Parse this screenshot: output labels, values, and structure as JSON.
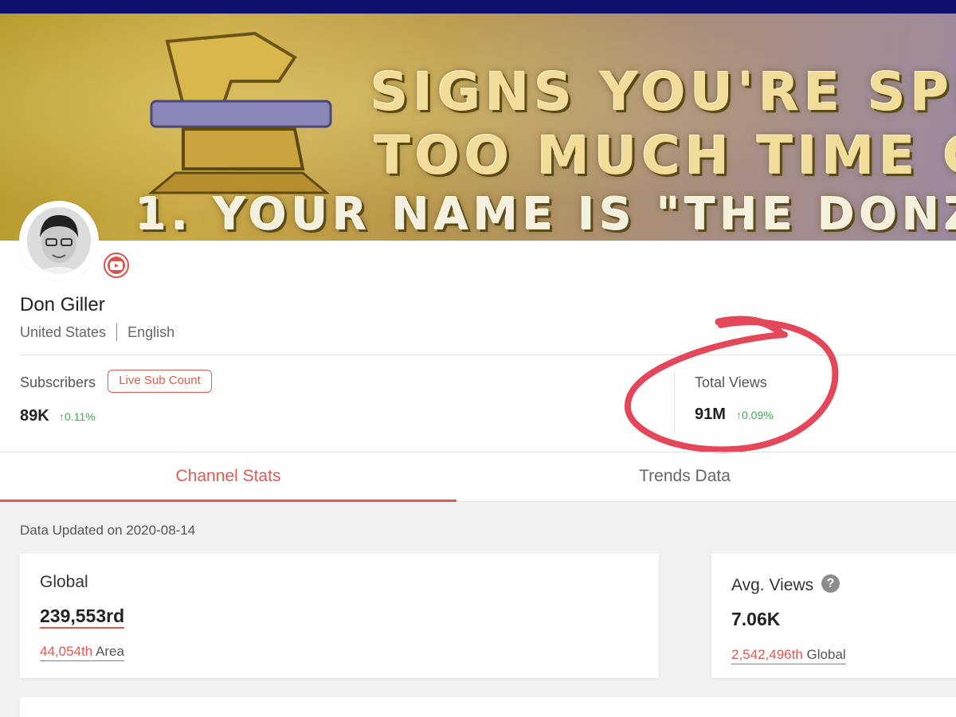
{
  "banner": {
    "line1": "SIGNS YOU'RE SPE",
    "line2": "TOO MUCH TIME C",
    "line3": "1. YOUR NAME IS \"THE DONZ"
  },
  "channel": {
    "name": "Don Giller",
    "country": "United States",
    "language": "English",
    "platform_icon": "youtube-icon"
  },
  "subscribers": {
    "label": "Subscribers",
    "live_button": "Live Sub Count",
    "value": "89K",
    "change": "0.11%"
  },
  "views": {
    "label": "Total Views",
    "value": "91M",
    "change": "0.09%"
  },
  "tabs": [
    {
      "label": "Channel Stats",
      "active": true
    },
    {
      "label": "Trends Data",
      "active": false
    }
  ],
  "updated": "Data Updated on 2020-08-14",
  "cards": {
    "global": {
      "title": "Global",
      "value": "239,553rd",
      "rank_num": "44,054th",
      "rank_label": "Area"
    },
    "avg_views": {
      "title": "Avg. Views",
      "value": "7.06K",
      "rank_num": "2,542,496th",
      "rank_label": "Global",
      "help_icon": "?"
    }
  },
  "colors": {
    "accent": "#e05a52",
    "positive": "#3aae52",
    "topbar": "#10106e"
  }
}
